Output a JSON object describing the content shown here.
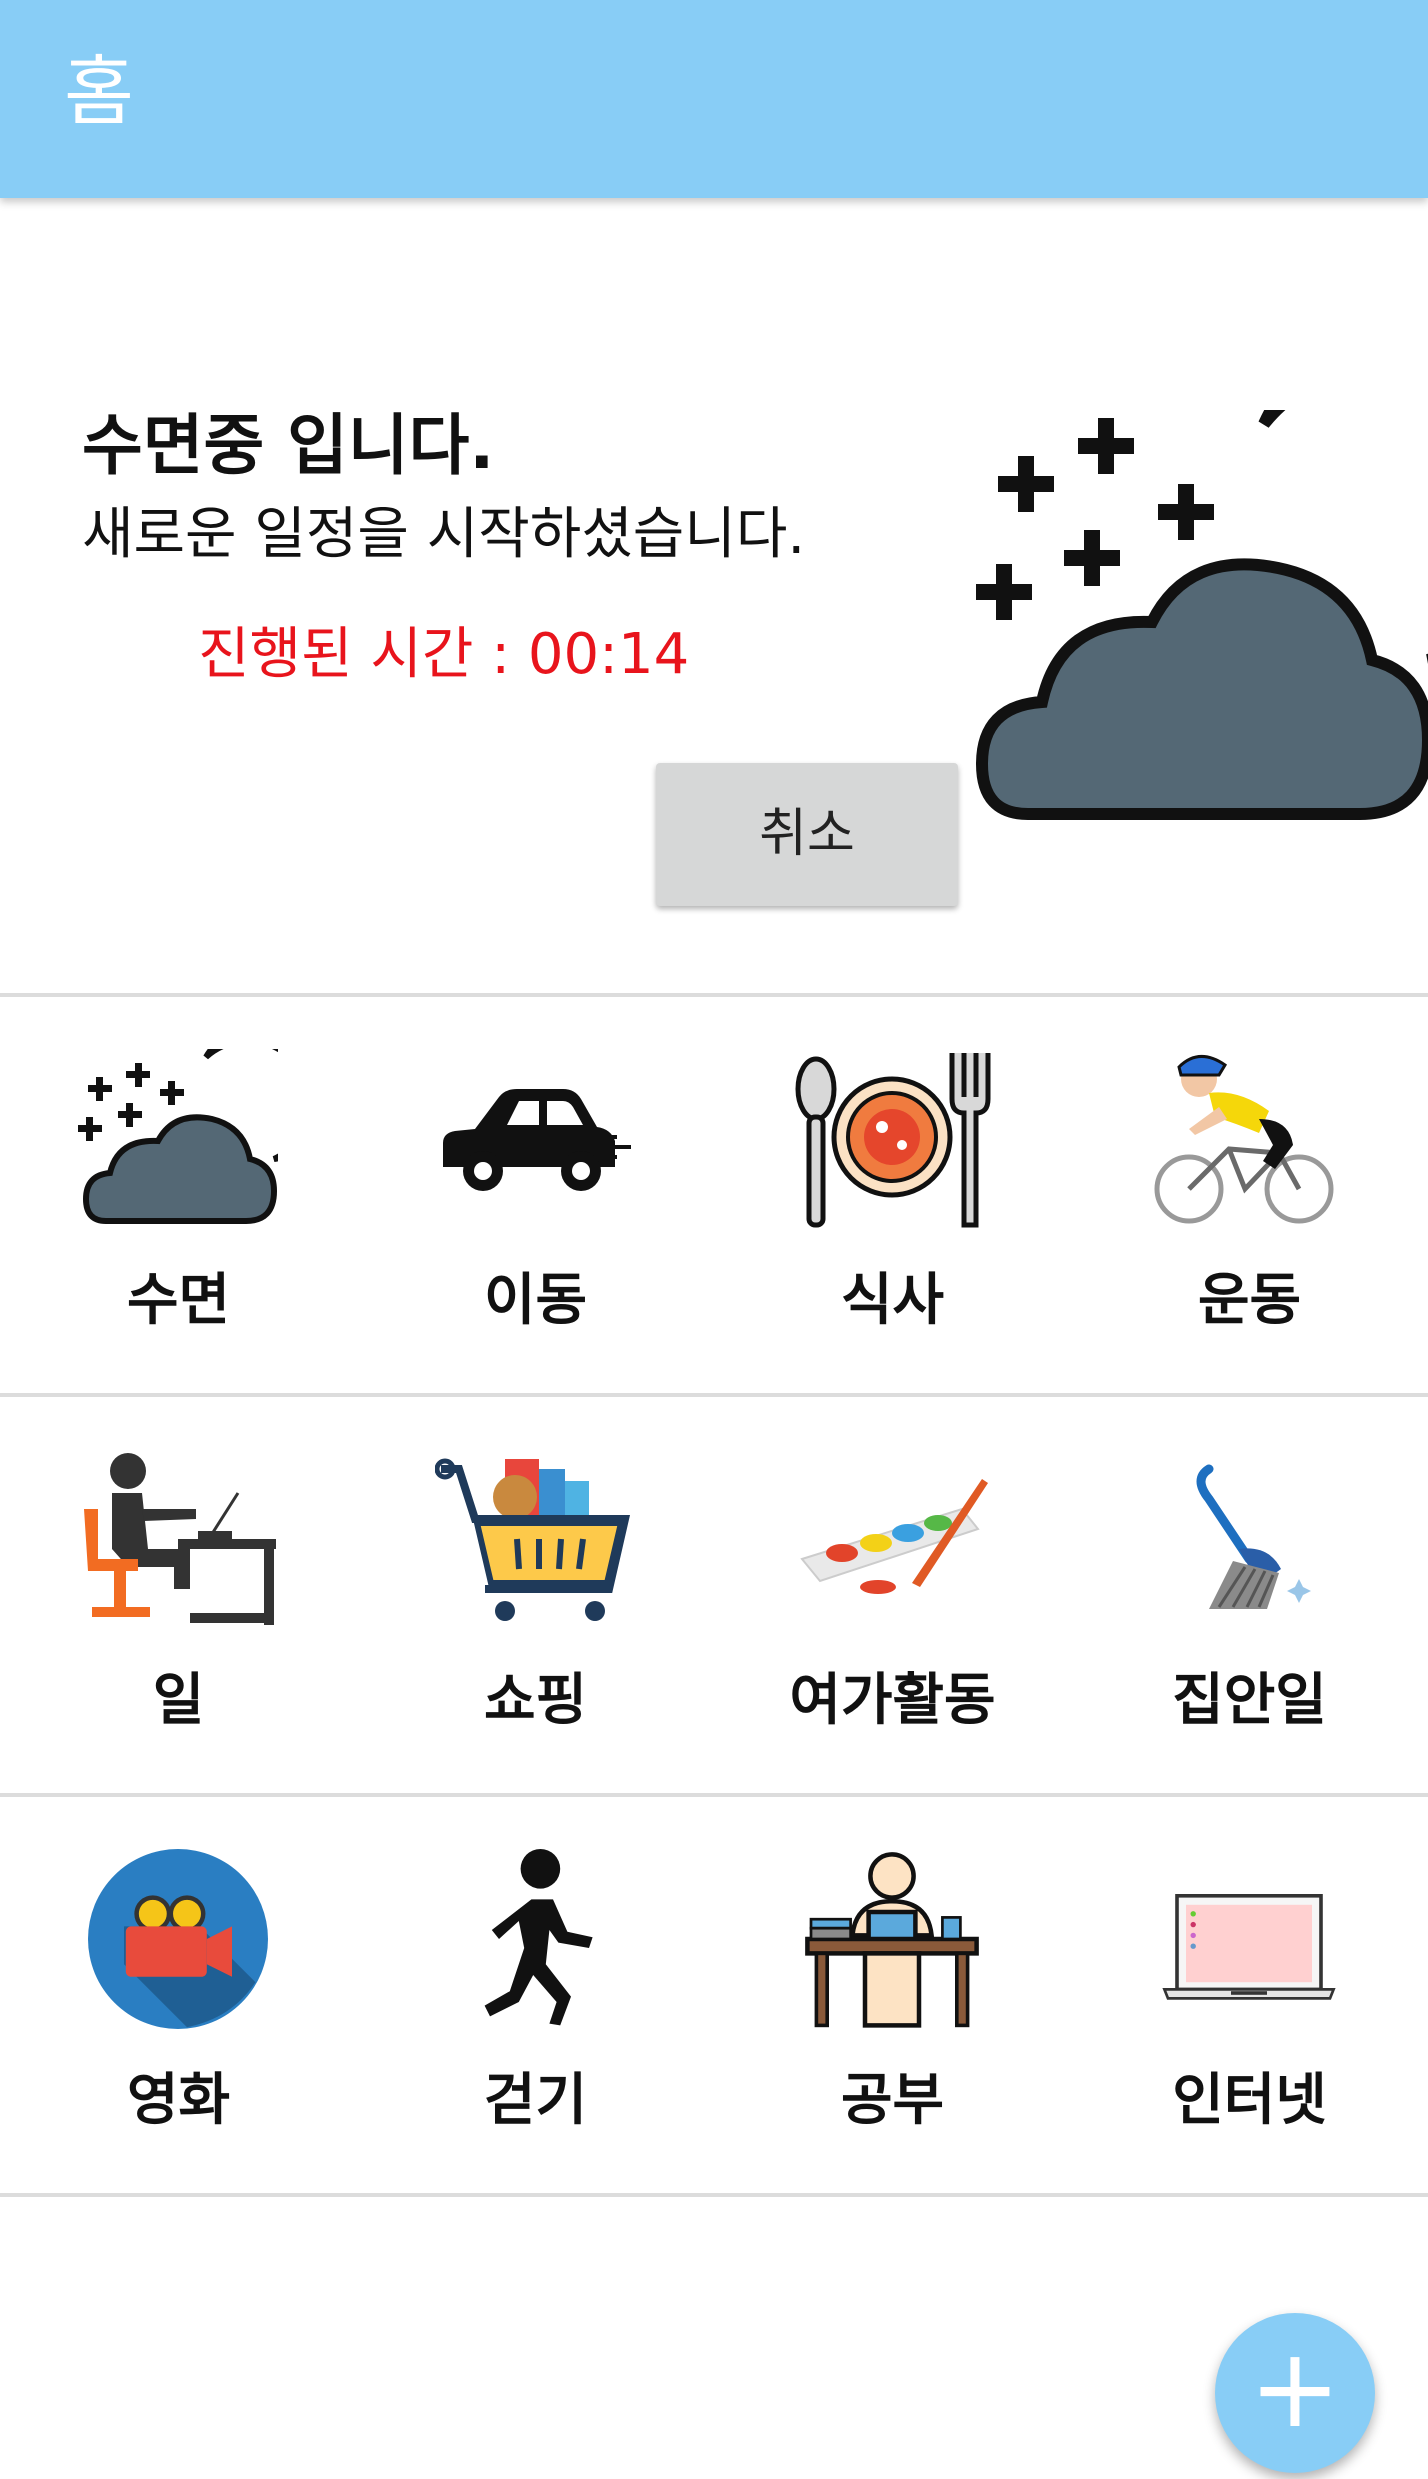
{
  "appbar": {
    "title": "홈"
  },
  "status": {
    "title": "수면중 입니다.",
    "subtitle": "새로운 일정을 시작하셨습니다.",
    "elapsed": "진행된 시간 : 00:14",
    "cancel_label": "취소",
    "icon": "sleep-moon-cloud-icon"
  },
  "categories": [
    {
      "label": "수면",
      "icon": "sleep-moon-cloud-icon"
    },
    {
      "label": "이동",
      "icon": "car-icon"
    },
    {
      "label": "식사",
      "icon": "meal-plate-icon"
    },
    {
      "label": "운동",
      "icon": "cyclist-icon"
    },
    {
      "label": "일",
      "icon": "desk-work-icon"
    },
    {
      "label": "쇼핑",
      "icon": "shopping-cart-icon"
    },
    {
      "label": "여가활동",
      "icon": "paint-palette-icon"
    },
    {
      "label": "집안일",
      "icon": "broom-icon"
    },
    {
      "label": "영화",
      "icon": "movie-camera-icon"
    },
    {
      "label": "걷기",
      "icon": "walking-person-icon"
    },
    {
      "label": "공부",
      "icon": "study-desk-icon"
    },
    {
      "label": "인터넷",
      "icon": "laptop-icon"
    }
  ],
  "fab": {
    "label": "+"
  },
  "colors": {
    "appbar": "#88cdf6",
    "elapsed_text": "#e8141c",
    "button_bg": "#d6d7d7",
    "divider": "#dcdcdc"
  }
}
